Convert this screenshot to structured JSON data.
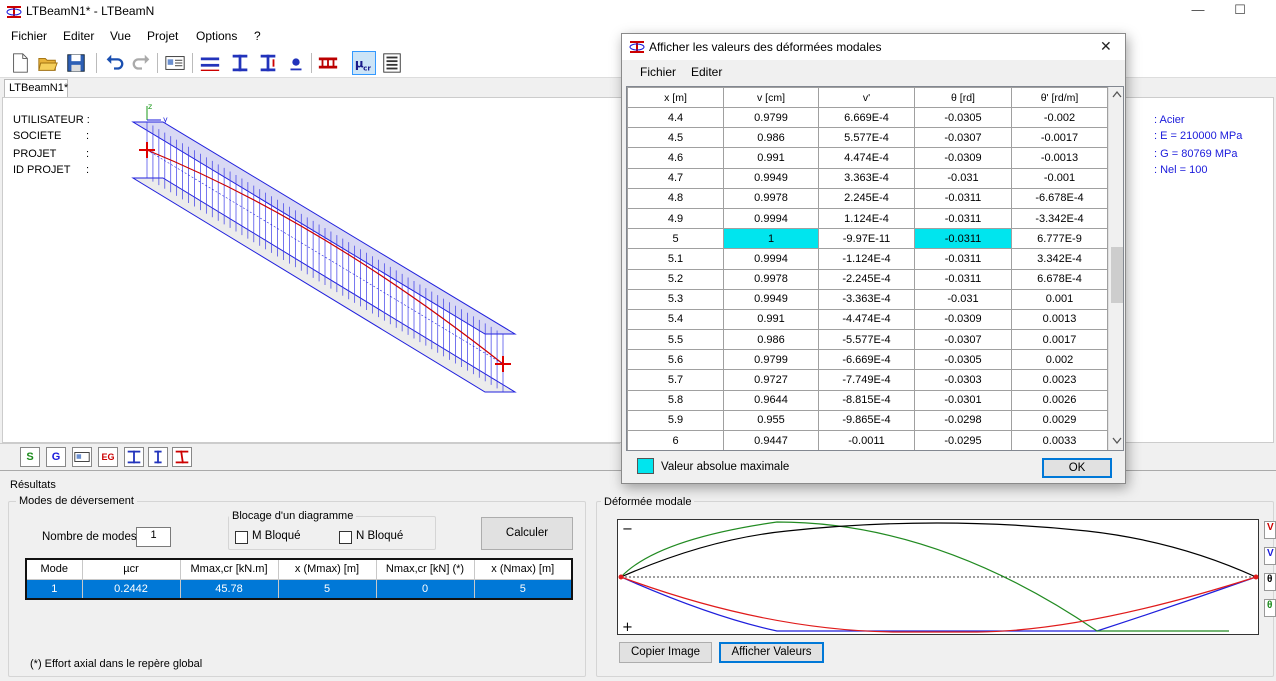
{
  "window": {
    "title": "LTBeamN1* - LTBeamN",
    "minimize": "—",
    "maximize": "☐"
  },
  "menu": [
    "Fichier",
    "Editer",
    "Vue",
    "Projet",
    "Options",
    "?"
  ],
  "doc_tab": "LTBeamN1*",
  "project_info": {
    "labels": [
      "UTILISATEUR :",
      "SOCIETE",
      "PROJET",
      "ID PROJET"
    ],
    "colons": [
      ":",
      ":",
      ":"
    ]
  },
  "material": [
    ": Acier",
    ": E = 210000 MPa",
    ": G = 80769 MPa",
    ": Nel = 100"
  ],
  "bottom_toolbar": [
    "S",
    "G",
    "EG"
  ],
  "results": {
    "section_label": "Résultats",
    "modes_group": "Modes de déversement",
    "nb_modes_label": "Nombre de modes",
    "nb_modes_value": "1",
    "blocage_group": "Blocage d'un diagramme",
    "m_bloque": "M Bloqué",
    "n_bloque": "N Bloqué",
    "calculer": "Calculer",
    "table_headers": [
      "Mode",
      "µcr",
      "Mmax,cr [kN.m]",
      "x (Mmax) [m]",
      "Nmax,cr [kN] (*)",
      "x (Nmax) [m]"
    ],
    "table_rows": [
      [
        "1",
        "0.2442",
        "45.78",
        "5",
        "0",
        "5"
      ]
    ],
    "footnote": "(*) Effort axial dans le repère global"
  },
  "deformee": {
    "group": "Déformée modale",
    "minus": "−",
    "plus": "+",
    "copy_button": "Copier Image",
    "show_button": "Afficher Valeurs",
    "colors": {
      "v": "#1f1fdc",
      "vprime": "#228b22",
      "theta": "#000000",
      "thetaprime": "#e01b1b"
    }
  },
  "dialog": {
    "title": "Afficher les valeurs des déformées modales",
    "close": "✕",
    "menu": [
      "Fichier",
      "Editer"
    ],
    "headers": [
      "x [m]",
      "v [cm]",
      "v'",
      "θ [rd]",
      "θ' [rd/m]"
    ],
    "rows": [
      [
        "4.4",
        "0.9799",
        "6.669E-4",
        "-0.0305",
        "-0.002"
      ],
      [
        "4.5",
        "0.986",
        "5.577E-4",
        "-0.0307",
        "-0.0017"
      ],
      [
        "4.6",
        "0.991",
        "4.474E-4",
        "-0.0309",
        "-0.0013"
      ],
      [
        "4.7",
        "0.9949",
        "3.363E-4",
        "-0.031",
        "-0.001"
      ],
      [
        "4.8",
        "0.9978",
        "2.245E-4",
        "-0.0311",
        "-6.678E-4"
      ],
      [
        "4.9",
        "0.9994",
        "1.124E-4",
        "-0.0311",
        "-3.342E-4"
      ],
      [
        "5",
        "1",
        "-9.97E-11",
        "-0.0311",
        "6.777E-9"
      ],
      [
        "5.1",
        "0.9994",
        "-1.124E-4",
        "-0.0311",
        "3.342E-4"
      ],
      [
        "5.2",
        "0.9978",
        "-2.245E-4",
        "-0.0311",
        "6.678E-4"
      ],
      [
        "5.3",
        "0.9949",
        "-3.363E-4",
        "-0.031",
        "0.001"
      ],
      [
        "5.4",
        "0.991",
        "-4.474E-4",
        "-0.0309",
        "0.0013"
      ],
      [
        "5.5",
        "0.986",
        "-5.577E-4",
        "-0.0307",
        "0.0017"
      ],
      [
        "5.6",
        "0.9799",
        "-6.669E-4",
        "-0.0305",
        "0.002"
      ],
      [
        "5.7",
        "0.9727",
        "-7.749E-4",
        "-0.0303",
        "0.0023"
      ],
      [
        "5.8",
        "0.9644",
        "-8.815E-4",
        "-0.0301",
        "0.0026"
      ],
      [
        "5.9",
        "0.955",
        "-9.865E-4",
        "-0.0298",
        "0.0029"
      ],
      [
        "6",
        "0.9447",
        "-0.0011",
        "-0.0295",
        "0.0033"
      ]
    ],
    "highlight_row": 6,
    "highlight_cols": [
      1,
      3
    ],
    "legend": "Valeur absolue maximale",
    "highlight_color": "#00e5ee",
    "ok": "OK"
  }
}
